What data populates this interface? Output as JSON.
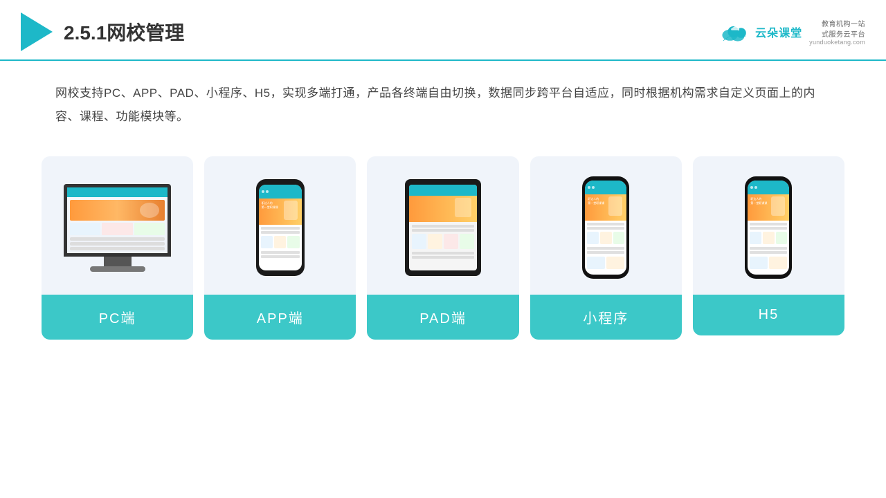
{
  "header": {
    "title": "2.5.1网校管理",
    "brand": {
      "name": "云朵课堂",
      "url": "yunduoketang.com",
      "subtitle": "教育机构一站\n式服务云平台"
    }
  },
  "description": "网校支持PC、APP、PAD、小程序、H5，实现多端打通，产品各终端自由切换，数据同步跨平台自适应，同时根据机构需求自定义页面上的内容、课程、功能模块等。",
  "cards": [
    {
      "id": "pc",
      "label": "PC端",
      "device": "pc"
    },
    {
      "id": "app",
      "label": "APP端",
      "device": "phone"
    },
    {
      "id": "pad",
      "label": "PAD端",
      "device": "ipad"
    },
    {
      "id": "mini",
      "label": "小程序",
      "device": "phone-tall"
    },
    {
      "id": "h5",
      "label": "H5",
      "device": "phone-tall"
    }
  ],
  "colors": {
    "accent": "#1db8c8",
    "label_bg": "#3cc8c8",
    "header_border": "#1db8c8"
  }
}
